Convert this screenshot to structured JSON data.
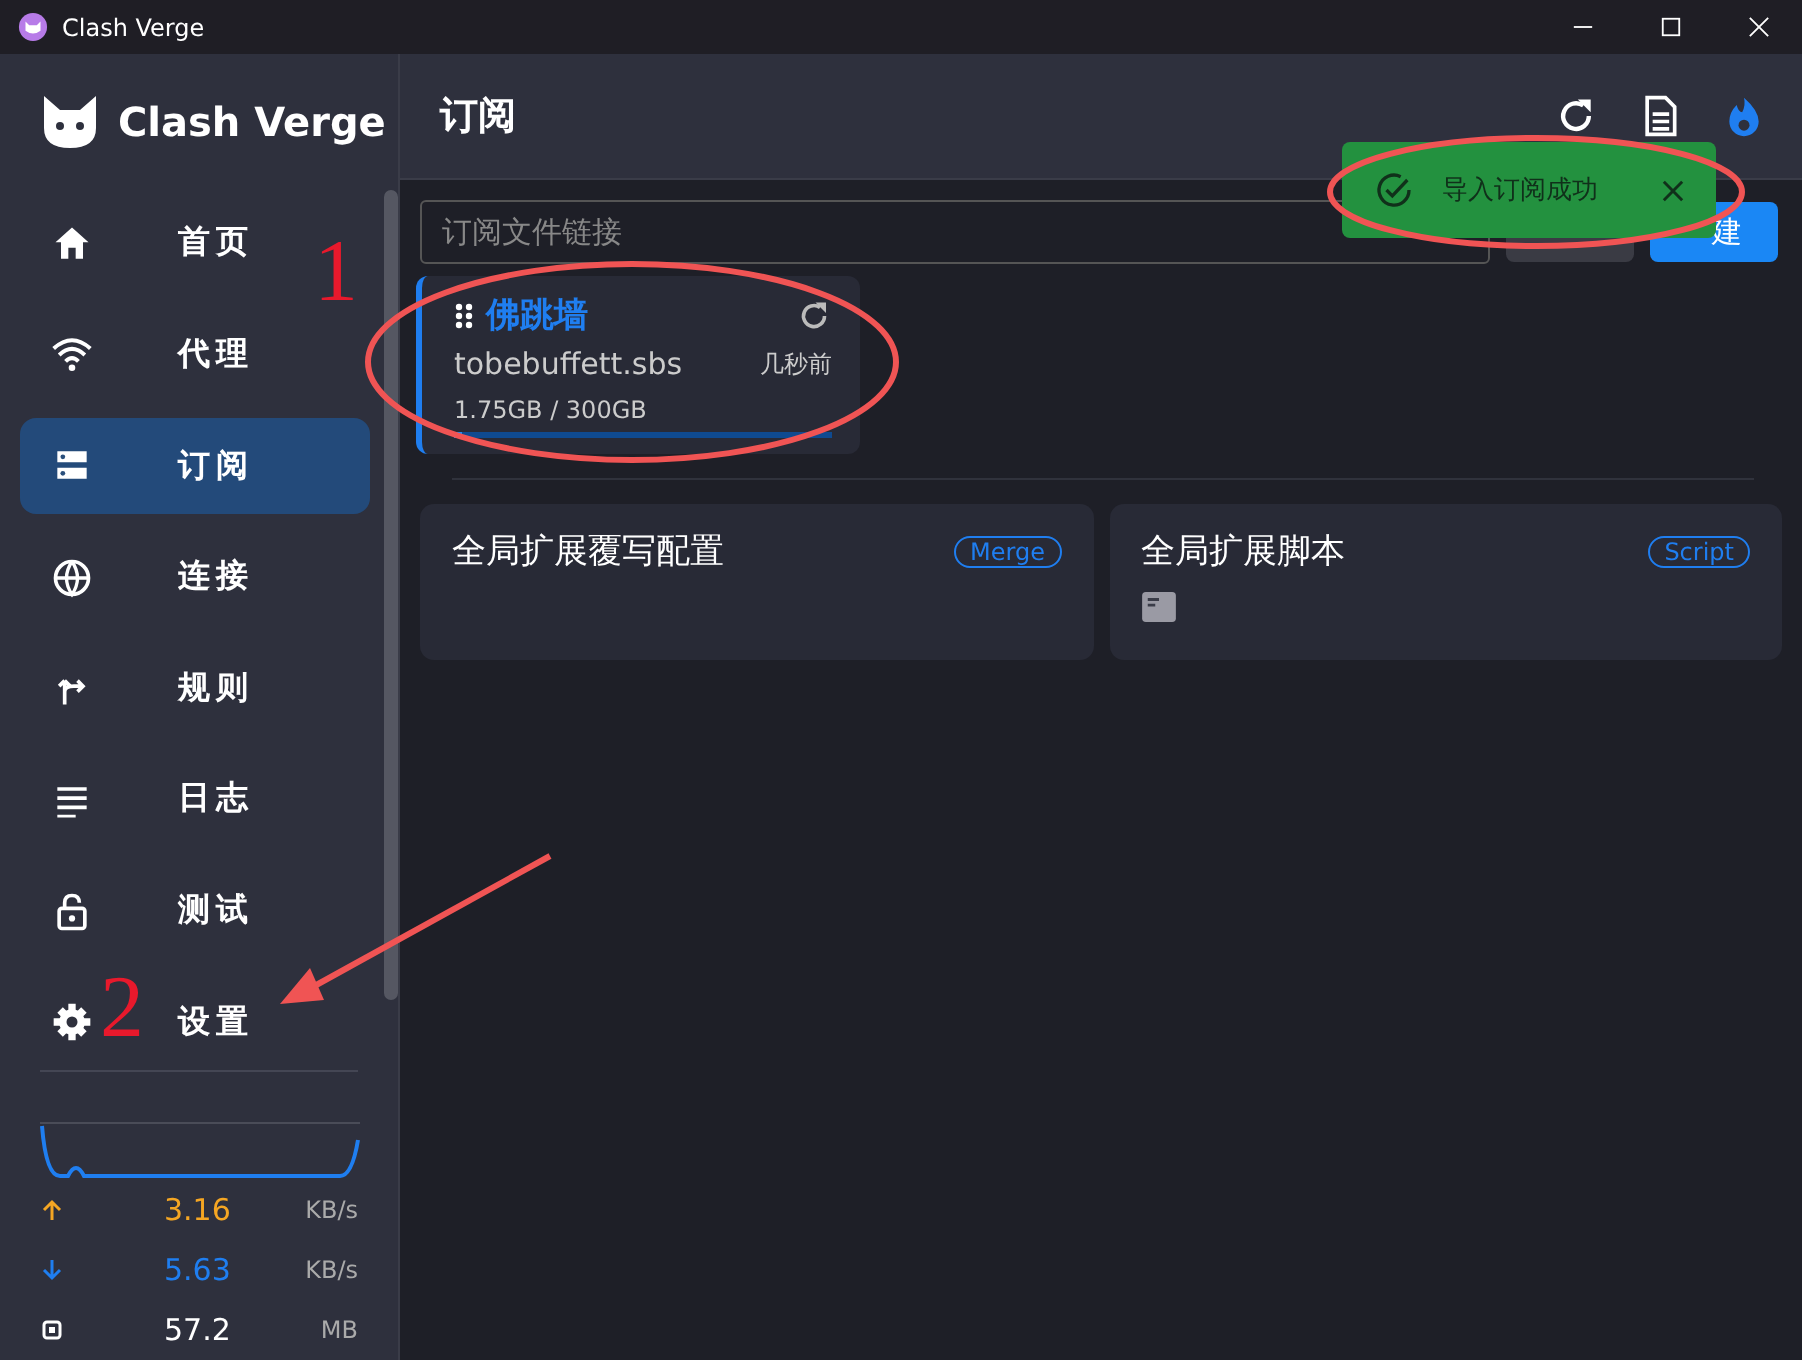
{
  "window": {
    "title": "Clash Verge"
  },
  "sidebar": {
    "logo": "Clash Verge",
    "items": [
      {
        "label": "首页",
        "selected": false
      },
      {
        "label": "代理",
        "selected": false
      },
      {
        "label": "订阅",
        "selected": true
      },
      {
        "label": "连接",
        "selected": false
      },
      {
        "label": "规则",
        "selected": false
      },
      {
        "label": "日志",
        "selected": false
      },
      {
        "label": "测试",
        "selected": false
      },
      {
        "label": "设置",
        "selected": false
      }
    ],
    "traffic": [
      {
        "kind": "up",
        "value": "3.16",
        "unit": "KB/s"
      },
      {
        "kind": "down",
        "value": "5.63",
        "unit": "KB/s"
      },
      {
        "kind": "memory",
        "value": "57.2",
        "unit": "MB"
      }
    ]
  },
  "header": {
    "title": "订阅"
  },
  "import_bar": {
    "placeholder": "订阅文件链接",
    "new_button": "建"
  },
  "profiles": [
    {
      "name": "佛跳墙",
      "host": "tobebuffett.sbs",
      "updated": "几秒前",
      "usage": "1.75GB / 300GB",
      "level": 0.02,
      "selected": true
    }
  ],
  "extensions": [
    {
      "title": "全局扩展覆写配置",
      "badge": "Merge",
      "kind": "merge"
    },
    {
      "title": "全局扩展脚本",
      "badge": "Script",
      "kind": "script"
    }
  ],
  "toast": {
    "message": "导入订阅成功"
  },
  "annotations": [
    {
      "label": "1"
    },
    {
      "label": "2"
    }
  ]
}
